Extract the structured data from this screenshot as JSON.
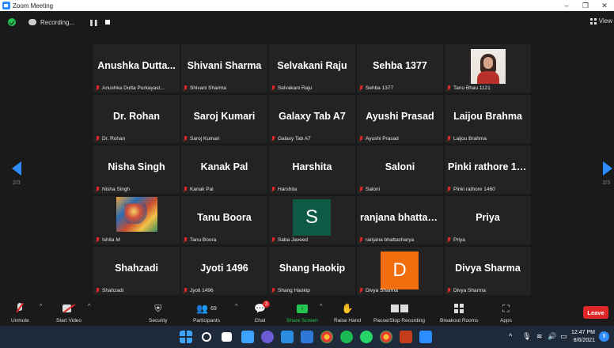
{
  "window": {
    "title": "Zoom Meeting",
    "min": "–",
    "restore": "❐",
    "close": "✕"
  },
  "topbar": {
    "recording_label": "Recording...",
    "pause_glyph": "❚❚",
    "view_label": "View"
  },
  "pagination": {
    "left": "2/3",
    "right": "2/3"
  },
  "participants": [
    {
      "big": "Anushka Dutta...",
      "label": "Anushka Dutta Purkayast..."
    },
    {
      "big": "Shivani Sharma",
      "label": "Shivani Sharma"
    },
    {
      "big": "Selvakani Raju",
      "label": "Selvakani Raju"
    },
    {
      "big": "Sehba 1377",
      "label": "Sehba 1377"
    },
    {
      "big": "",
      "label": "Tanu Bhau 1121",
      "photo": "tanu"
    },
    {
      "big": "Dr. Rohan",
      "label": "Dr. Rohan"
    },
    {
      "big": "Saroj Kumari",
      "label": "Saroj Kumari"
    },
    {
      "big": "Galaxy Tab A7",
      "label": "Galaxy Tab A7"
    },
    {
      "big": "Ayushi Prasad",
      "label": "Ayushi Prasad"
    },
    {
      "big": "Laijou Brahma",
      "label": "Laijou Brahma"
    },
    {
      "big": "Nisha Singh",
      "label": "Nisha Singh"
    },
    {
      "big": "Kanak Pal",
      "label": "Kanak Pal"
    },
    {
      "big": "Harshita",
      "label": "Harshita"
    },
    {
      "big": "Saloni",
      "label": "Saloni"
    },
    {
      "big": "Pinki rathore 14...",
      "label": "Pinki rathore 1460"
    },
    {
      "big": "",
      "label": "Ishita M",
      "photo": "ishita"
    },
    {
      "big": "Tanu Boora",
      "label": "Tanu Boora"
    },
    {
      "big": "",
      "label": "Saba Javeed",
      "avatar": "S"
    },
    {
      "big": "ranjana bhattac...",
      "label": "ranjana bhattacharya"
    },
    {
      "big": "Priya",
      "label": "Priya"
    },
    {
      "big": "Shahzadi",
      "label": "Shahzadi"
    },
    {
      "big": "Jyoti 1496",
      "label": "Jyoti 1496"
    },
    {
      "big": "Shang Haokip",
      "label": "Shang Haokip"
    },
    {
      "big": "",
      "label": "Divya Sharma",
      "avatar": "D"
    },
    {
      "big": "Divya Sharma",
      "label": "Divya Sharma"
    }
  ],
  "toolbar": {
    "unmute": "Unmute",
    "start_video": "Start Video",
    "security": "Security",
    "participants": "Participants",
    "participants_count": "69",
    "chat": "Chat",
    "chat_badge": "3",
    "share_screen": "Share Screen",
    "raise_hand": "Raise Hand",
    "pause_stop_recording": "Pause/Stop Recording",
    "breakout_rooms": "Breakout Rooms",
    "apps": "Apps",
    "leave": "Leave",
    "caret": "^"
  },
  "taskbar": {
    "time": "12:47 PM",
    "date": "8/6/2021",
    "notify": "9"
  },
  "colors": {
    "accent": "#2d8cff",
    "leave": "#e02828",
    "share": "#23c552",
    "avatar_s": "#0e5a44",
    "avatar_d": "#f26d0d"
  }
}
